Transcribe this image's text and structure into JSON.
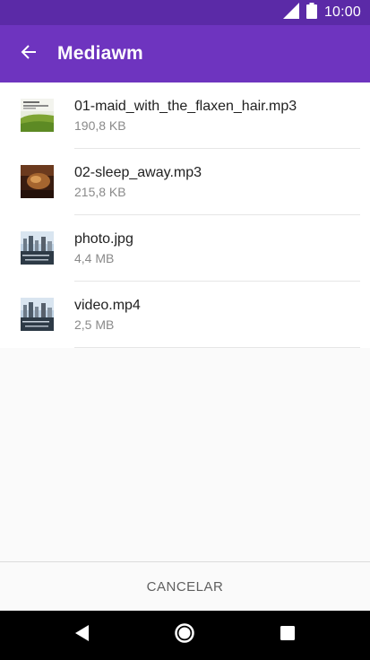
{
  "status_bar": {
    "time": "10:00",
    "icons": [
      "signal-icon",
      "battery-icon"
    ]
  },
  "app_bar": {
    "title": "Mediawm",
    "back_icon": "arrow-back-icon"
  },
  "files": [
    {
      "name": "01-maid_with_the_flaxen_hair.mp3",
      "size": "190,8 KB",
      "thumb": "album-art-thumbnail-green"
    },
    {
      "name": "02-sleep_away.mp3",
      "size": "215,8 KB",
      "thumb": "album-art-thumbnail-brown"
    },
    {
      "name": "photo.jpg",
      "size": "4,4 MB",
      "thumb": "city-harbor-thumbnail"
    },
    {
      "name": "video.mp4",
      "size": "2,5 MB",
      "thumb": "city-harbor-thumbnail"
    }
  ],
  "actions": {
    "cancel_label": "CANCELAR"
  },
  "nav_bar": {
    "icons": [
      "back-triangle-icon",
      "home-circle-icon",
      "recents-square-icon"
    ]
  },
  "colors": {
    "status_bar": "#5b2aa7",
    "app_bar": "#6e34bf",
    "background": "#fafafa"
  }
}
